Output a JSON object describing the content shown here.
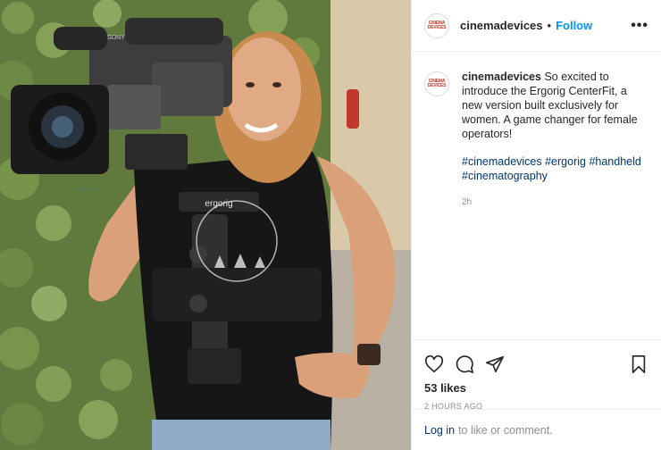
{
  "post": {
    "username": "cinemadevices",
    "follow_label": "Follow",
    "separator": "•",
    "more_label": "•••",
    "avatar_logo": "CINEMA DEVICES",
    "caption_text": "So excited to introduce the Ergorig CenterFit, a new version built exclusively for women. A game changer for female operators!",
    "hashtags": "#cinemadevices #ergorig #handheld #cinematography",
    "caption_time": "2h",
    "likes": "53 likes",
    "posted_time": "2 HOURS AGO",
    "login_link": "Log in",
    "login_suffix": "to like or comment."
  },
  "photo": {
    "vest_brand": "ergorig",
    "camera_brand": "SONY"
  },
  "colors": {
    "follow": "#0095f6",
    "hashtag": "#00376b",
    "muted": "#8e8e8e"
  }
}
